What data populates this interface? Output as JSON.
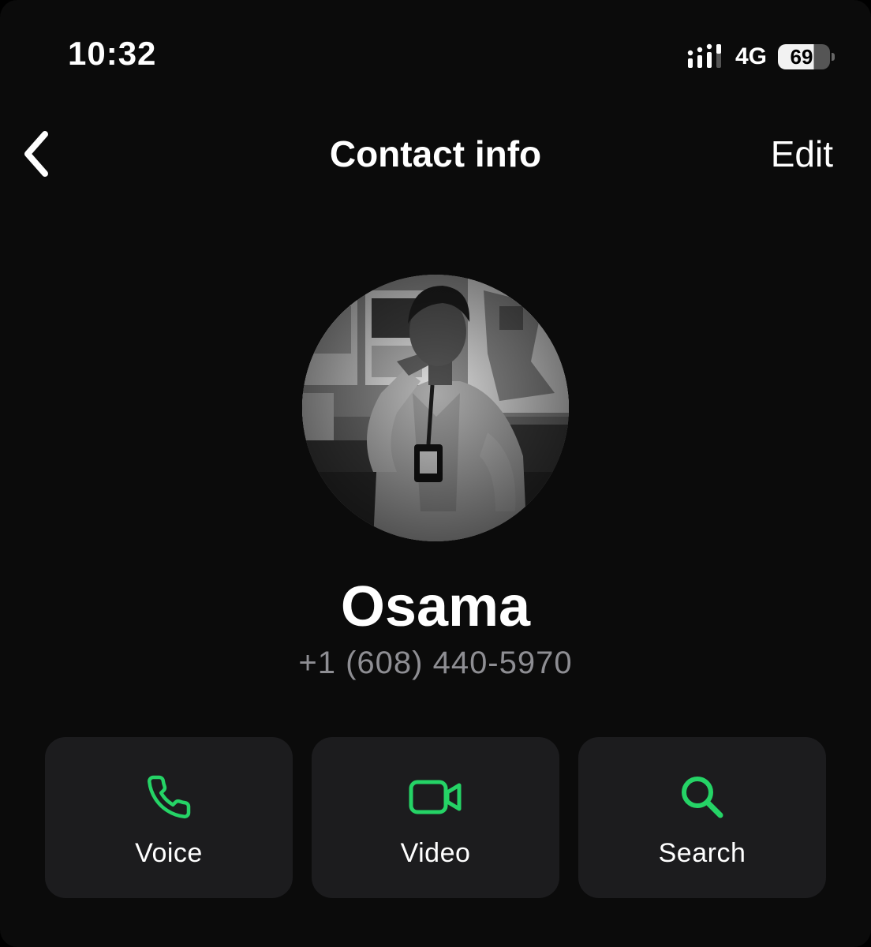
{
  "status_bar": {
    "time": "10:32",
    "network": "4G",
    "battery_level": "69",
    "battery_fraction": 0.69
  },
  "nav": {
    "back_icon": "chevron-left-icon",
    "title": "Contact info",
    "edit_label": "Edit"
  },
  "contact": {
    "name": "Osama",
    "phone": "+1 (608) 440-5970",
    "avatar": "profile-photo"
  },
  "actions": [
    {
      "label": "Voice",
      "icon": "phone-icon"
    },
    {
      "label": "Video",
      "icon": "video-camera-icon"
    },
    {
      "label": "Search",
      "icon": "search-icon"
    }
  ],
  "colors": {
    "background": "#0b0b0b",
    "card": "#1c1c1e",
    "accent_green": "#25d366",
    "secondary_text": "#8e8e93"
  }
}
